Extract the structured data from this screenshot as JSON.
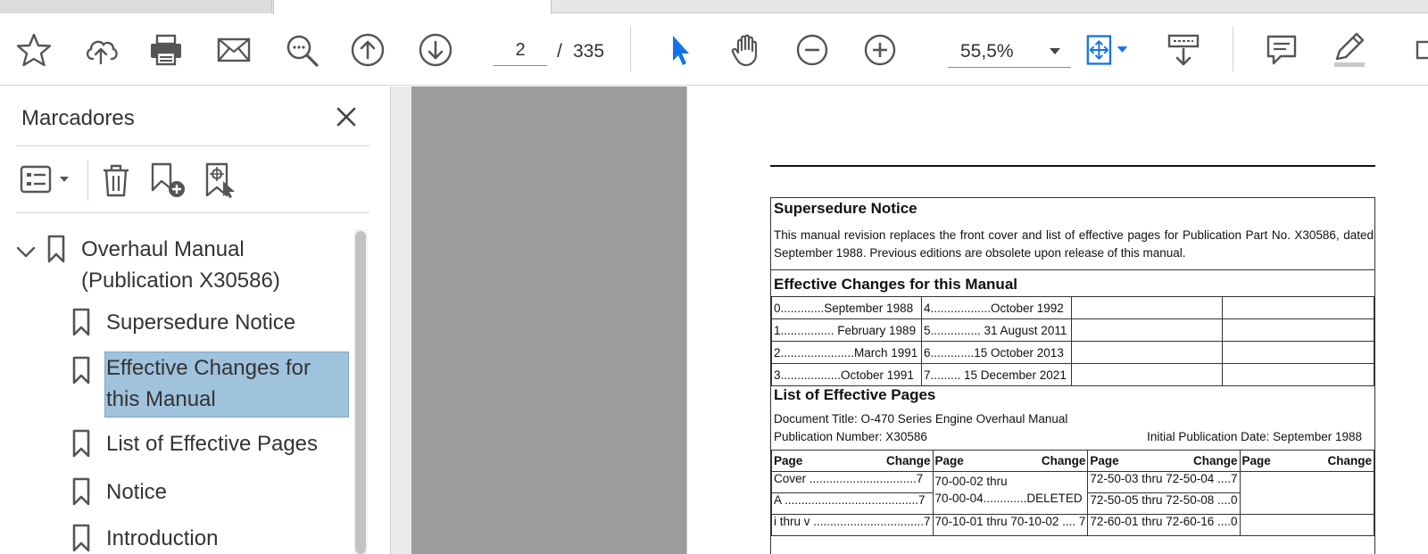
{
  "toolbar": {
    "page_current": "2",
    "page_separator": "/",
    "page_total": "335",
    "zoom": "55,5%",
    "accent_color": "#1473e6"
  },
  "sidebar": {
    "title": "Marcadores",
    "bookmarks": [
      {
        "label_line1": "Overhaul Manual",
        "label_line2": "(Publication X30586)",
        "expanded": true
      },
      {
        "label": "Supersedure Notice"
      },
      {
        "label_line1": "Effective Changes for",
        "label_line2": "this Manual",
        "selected": true
      },
      {
        "label": "List of Effective Pages"
      },
      {
        "label": "Notice"
      },
      {
        "label": "Introduction"
      }
    ]
  },
  "document": {
    "supersedure_heading": "Supersedure Notice",
    "supersedure_text": "This manual revision replaces the front cover and list of effective pages for Publication Part No. X30586, dated September 1988. Previous editions are obsolete upon release of this manual.",
    "changes_heading": "Effective Changes for this Manual",
    "changes": [
      [
        "0.............September 1988",
        "4..................October 1992"
      ],
      [
        "1................ February 1989",
        "5............... 31 August 2011"
      ],
      [
        "2......................March 1991",
        "6.............15 October 2013"
      ],
      [
        "3..................October 1991",
        "7......... 15 December 2021"
      ]
    ],
    "lep_heading": "List of Effective Pages",
    "doc_title": "Document Title: O-470 Series Engine Overhaul Manual",
    "pub_number": "Publication Number: X30586",
    "initial_date": "Initial Publication Date: September 1988",
    "col_page": "Page",
    "col_change": "Change",
    "lep_rows": [
      {
        "c1": "Cover ................................7",
        "c2a": "70-00-02 thru",
        "c2b": "70-00-04.............DELETED",
        "c3": "72-50-03 thru 72-50-04 ....7"
      },
      {
        "c1": "A ........................................7",
        "c3": "72-50-05 thru 72-50-08 ....0"
      },
      {
        "c1": "i thru v .................................7",
        "c2": "70-10-01 thru 70-10-02 .... 7",
        "c3": "72-60-01 thru 72-60-16 ....0"
      }
    ]
  }
}
